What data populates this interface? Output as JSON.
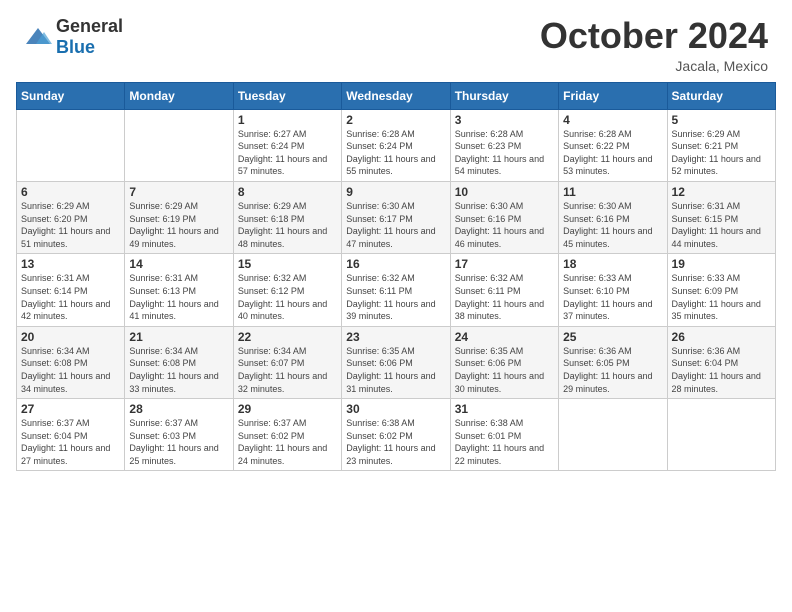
{
  "header": {
    "logo_general": "General",
    "logo_blue": "Blue",
    "month_title": "October 2024",
    "location": "Jacala, Mexico"
  },
  "weekdays": [
    "Sunday",
    "Monday",
    "Tuesday",
    "Wednesday",
    "Thursday",
    "Friday",
    "Saturday"
  ],
  "weeks": [
    [
      {
        "day": "",
        "sunrise": "",
        "sunset": "",
        "daylight": ""
      },
      {
        "day": "",
        "sunrise": "",
        "sunset": "",
        "daylight": ""
      },
      {
        "day": "1",
        "sunrise": "Sunrise: 6:27 AM",
        "sunset": "Sunset: 6:24 PM",
        "daylight": "Daylight: 11 hours and 57 minutes."
      },
      {
        "day": "2",
        "sunrise": "Sunrise: 6:28 AM",
        "sunset": "Sunset: 6:24 PM",
        "daylight": "Daylight: 11 hours and 55 minutes."
      },
      {
        "day": "3",
        "sunrise": "Sunrise: 6:28 AM",
        "sunset": "Sunset: 6:23 PM",
        "daylight": "Daylight: 11 hours and 54 minutes."
      },
      {
        "day": "4",
        "sunrise": "Sunrise: 6:28 AM",
        "sunset": "Sunset: 6:22 PM",
        "daylight": "Daylight: 11 hours and 53 minutes."
      },
      {
        "day": "5",
        "sunrise": "Sunrise: 6:29 AM",
        "sunset": "Sunset: 6:21 PM",
        "daylight": "Daylight: 11 hours and 52 minutes."
      }
    ],
    [
      {
        "day": "6",
        "sunrise": "Sunrise: 6:29 AM",
        "sunset": "Sunset: 6:20 PM",
        "daylight": "Daylight: 11 hours and 51 minutes."
      },
      {
        "day": "7",
        "sunrise": "Sunrise: 6:29 AM",
        "sunset": "Sunset: 6:19 PM",
        "daylight": "Daylight: 11 hours and 49 minutes."
      },
      {
        "day": "8",
        "sunrise": "Sunrise: 6:29 AM",
        "sunset": "Sunset: 6:18 PM",
        "daylight": "Daylight: 11 hours and 48 minutes."
      },
      {
        "day": "9",
        "sunrise": "Sunrise: 6:30 AM",
        "sunset": "Sunset: 6:17 PM",
        "daylight": "Daylight: 11 hours and 47 minutes."
      },
      {
        "day": "10",
        "sunrise": "Sunrise: 6:30 AM",
        "sunset": "Sunset: 6:16 PM",
        "daylight": "Daylight: 11 hours and 46 minutes."
      },
      {
        "day": "11",
        "sunrise": "Sunrise: 6:30 AM",
        "sunset": "Sunset: 6:16 PM",
        "daylight": "Daylight: 11 hours and 45 minutes."
      },
      {
        "day": "12",
        "sunrise": "Sunrise: 6:31 AM",
        "sunset": "Sunset: 6:15 PM",
        "daylight": "Daylight: 11 hours and 44 minutes."
      }
    ],
    [
      {
        "day": "13",
        "sunrise": "Sunrise: 6:31 AM",
        "sunset": "Sunset: 6:14 PM",
        "daylight": "Daylight: 11 hours and 42 minutes."
      },
      {
        "day": "14",
        "sunrise": "Sunrise: 6:31 AM",
        "sunset": "Sunset: 6:13 PM",
        "daylight": "Daylight: 11 hours and 41 minutes."
      },
      {
        "day": "15",
        "sunrise": "Sunrise: 6:32 AM",
        "sunset": "Sunset: 6:12 PM",
        "daylight": "Daylight: 11 hours and 40 minutes."
      },
      {
        "day": "16",
        "sunrise": "Sunrise: 6:32 AM",
        "sunset": "Sunset: 6:11 PM",
        "daylight": "Daylight: 11 hours and 39 minutes."
      },
      {
        "day": "17",
        "sunrise": "Sunrise: 6:32 AM",
        "sunset": "Sunset: 6:11 PM",
        "daylight": "Daylight: 11 hours and 38 minutes."
      },
      {
        "day": "18",
        "sunrise": "Sunrise: 6:33 AM",
        "sunset": "Sunset: 6:10 PM",
        "daylight": "Daylight: 11 hours and 37 minutes."
      },
      {
        "day": "19",
        "sunrise": "Sunrise: 6:33 AM",
        "sunset": "Sunset: 6:09 PM",
        "daylight": "Daylight: 11 hours and 35 minutes."
      }
    ],
    [
      {
        "day": "20",
        "sunrise": "Sunrise: 6:34 AM",
        "sunset": "Sunset: 6:08 PM",
        "daylight": "Daylight: 11 hours and 34 minutes."
      },
      {
        "day": "21",
        "sunrise": "Sunrise: 6:34 AM",
        "sunset": "Sunset: 6:08 PM",
        "daylight": "Daylight: 11 hours and 33 minutes."
      },
      {
        "day": "22",
        "sunrise": "Sunrise: 6:34 AM",
        "sunset": "Sunset: 6:07 PM",
        "daylight": "Daylight: 11 hours and 32 minutes."
      },
      {
        "day": "23",
        "sunrise": "Sunrise: 6:35 AM",
        "sunset": "Sunset: 6:06 PM",
        "daylight": "Daylight: 11 hours and 31 minutes."
      },
      {
        "day": "24",
        "sunrise": "Sunrise: 6:35 AM",
        "sunset": "Sunset: 6:06 PM",
        "daylight": "Daylight: 11 hours and 30 minutes."
      },
      {
        "day": "25",
        "sunrise": "Sunrise: 6:36 AM",
        "sunset": "Sunset: 6:05 PM",
        "daylight": "Daylight: 11 hours and 29 minutes."
      },
      {
        "day": "26",
        "sunrise": "Sunrise: 6:36 AM",
        "sunset": "Sunset: 6:04 PM",
        "daylight": "Daylight: 11 hours and 28 minutes."
      }
    ],
    [
      {
        "day": "27",
        "sunrise": "Sunrise: 6:37 AM",
        "sunset": "Sunset: 6:04 PM",
        "daylight": "Daylight: 11 hours and 27 minutes."
      },
      {
        "day": "28",
        "sunrise": "Sunrise: 6:37 AM",
        "sunset": "Sunset: 6:03 PM",
        "daylight": "Daylight: 11 hours and 25 minutes."
      },
      {
        "day": "29",
        "sunrise": "Sunrise: 6:37 AM",
        "sunset": "Sunset: 6:02 PM",
        "daylight": "Daylight: 11 hours and 24 minutes."
      },
      {
        "day": "30",
        "sunrise": "Sunrise: 6:38 AM",
        "sunset": "Sunset: 6:02 PM",
        "daylight": "Daylight: 11 hours and 23 minutes."
      },
      {
        "day": "31",
        "sunrise": "Sunrise: 6:38 AM",
        "sunset": "Sunset: 6:01 PM",
        "daylight": "Daylight: 11 hours and 22 minutes."
      },
      {
        "day": "",
        "sunrise": "",
        "sunset": "",
        "daylight": ""
      },
      {
        "day": "",
        "sunrise": "",
        "sunset": "",
        "daylight": ""
      }
    ]
  ]
}
